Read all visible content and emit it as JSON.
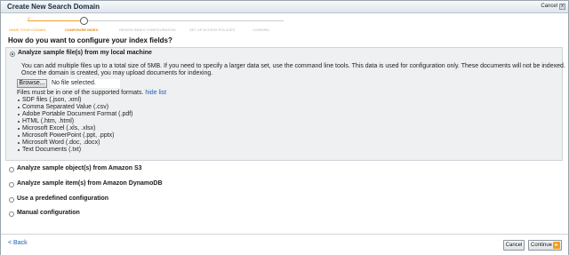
{
  "dialog": {
    "title": "Create New Search Domain",
    "cancel_top": "Cancel",
    "close_glyph": "x"
  },
  "steps": [
    {
      "label": "NAME YOUR DOMAIN",
      "state": "done"
    },
    {
      "label": "CONFIGURE INDEX",
      "state": "current"
    },
    {
      "label": "REVIEW INDEX CONFIGURATION",
      "state": "pending"
    },
    {
      "label": "SET UP ACCESS POLICIES",
      "state": "pending"
    },
    {
      "label": "CONFIRM",
      "state": "pending"
    }
  ],
  "question": "How do you want to configure your index fields?",
  "options": [
    {
      "label": "Analyze sample file(s) from my local machine",
      "selected": true
    },
    {
      "label": "Analyze sample object(s) from Amazon S3",
      "selected": false
    },
    {
      "label": "Analyze sample item(s) from Amazon DynamoDB",
      "selected": false
    },
    {
      "label": "Use a predefined configuration",
      "selected": false
    },
    {
      "label": "Manual configuration",
      "selected": false
    }
  ],
  "local": {
    "line1": "You can add multiple files up to a total size of 5MB. If you need to specify a larger data set, use the command line tools. This data is used for configuration only. These documents will not be indexed.",
    "line2": "Once the domain is created, you may upload documents for indexing.",
    "browse_label": "Browse...",
    "file_status": "No file selected.",
    "formats_intro": "Files must be in one of the supported formats.",
    "hide_link": "hide list",
    "formats": [
      "SDF files (.json, .xml)",
      "Comma Separated Value (.csv)",
      "Adobe Portable Document Format (.pdf)",
      "HTML (.htm, .html)",
      "Microsoft Excel (.xls, .xlsx)",
      "Microsoft PowerPoint (.ppt, .pptx)",
      "Microsoft Word (.doc, .docx)",
      "Text Documents (.txt)"
    ]
  },
  "footer": {
    "back": "< Back",
    "cancel": "Cancel",
    "continue": "Continue"
  },
  "colors": {
    "accent": "#f0a020",
    "link": "#1a5fb4",
    "panel": "#eef0f2"
  }
}
